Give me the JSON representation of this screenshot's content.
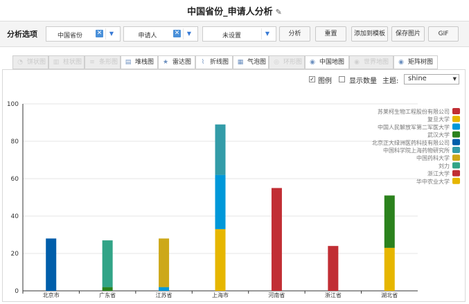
{
  "title": "中国省份_申请人分析",
  "options": {
    "label": "分析选项",
    "select1": "中国省份",
    "select2": "申请人",
    "select3": "未设置",
    "buttons": {
      "analyze": "分析",
      "reset": "重置",
      "add_template": "添加到模板",
      "save_image": "保存图片",
      "gif": "GIF"
    }
  },
  "tabs": [
    {
      "label": "饼状图",
      "icon": "pie-chart-icon",
      "disabled": true
    },
    {
      "label": "柱状图",
      "icon": "bar-chart-icon",
      "disabled": true
    },
    {
      "label": "条形图",
      "icon": "horizontal-bar-icon",
      "disabled": true
    },
    {
      "label": "堆栈图",
      "icon": "stacked-bar-icon",
      "disabled": false
    },
    {
      "label": "雷达图",
      "icon": "radar-chart-icon",
      "disabled": false
    },
    {
      "label": "折线图",
      "icon": "line-chart-icon",
      "disabled": false
    },
    {
      "label": "气泡图",
      "icon": "bubble-chart-icon",
      "disabled": false
    },
    {
      "label": "环形图",
      "icon": "ring-chart-icon",
      "disabled": true
    },
    {
      "label": "中国地图",
      "icon": "china-map-icon",
      "disabled": false
    },
    {
      "label": "世界地图",
      "icon": "world-map-icon",
      "disabled": true
    },
    {
      "label": "矩阵树图",
      "icon": "treemap-icon",
      "disabled": false
    }
  ],
  "controls": {
    "legend_label": "图例",
    "legend_checked": true,
    "show_count_label": "显示数量",
    "show_count_checked": false,
    "theme_label": "主题:",
    "theme_value": "shine"
  },
  "chart_data": {
    "type": "bar",
    "stacked": true,
    "categories": [
      "北京市",
      "广东省",
      "江苏省",
      "上海市",
      "河南省",
      "浙江省",
      "湖北省"
    ],
    "ylim": [
      0,
      100
    ],
    "yticks": [
      0,
      20,
      40,
      60,
      80,
      100
    ],
    "grid": true,
    "legend_position": "top-right",
    "series": [
      {
        "name": "苏莱柯生物工程股份有限公司",
        "color": "#c12e34",
        "values": [
          0,
          0,
          0,
          0,
          55,
          24,
          0
        ]
      },
      {
        "name": "复旦大学",
        "color": "#e6b600",
        "values": [
          0,
          0,
          0,
          33,
          0,
          0,
          23
        ]
      },
      {
        "name": "中国人民解放军第二军医大学",
        "color": "#0098d9",
        "values": [
          0,
          0,
          2,
          29,
          0,
          0,
          0
        ]
      },
      {
        "name": "武汉大学",
        "color": "#2b821d",
        "values": [
          0,
          2,
          0,
          0,
          0,
          0,
          28
        ]
      },
      {
        "name": "北京正大绿洲医药科技有限公司",
        "color": "#005eaa",
        "values": [
          28,
          0,
          0,
          0,
          0,
          0,
          0
        ]
      },
      {
        "name": "中国科学院上海药物研究所",
        "color": "#339ca8",
        "values": [
          0,
          0,
          0,
          27,
          0,
          0,
          0
        ]
      },
      {
        "name": "中国药科大学",
        "color": "#cda819",
        "values": [
          0,
          0,
          26,
          0,
          0,
          0,
          0
        ]
      },
      {
        "name": "刘力",
        "color": "#32a487",
        "values": [
          0,
          25,
          0,
          0,
          0,
          0,
          0
        ]
      },
      {
        "name": "浙江大学",
        "color": "#c12e34",
        "values": [
          0,
          0,
          0,
          0,
          0,
          0,
          0
        ]
      },
      {
        "name": "华中农业大学",
        "color": "#e6b600",
        "values": [
          0,
          0,
          0,
          0,
          0,
          0,
          0
        ]
      }
    ]
  }
}
